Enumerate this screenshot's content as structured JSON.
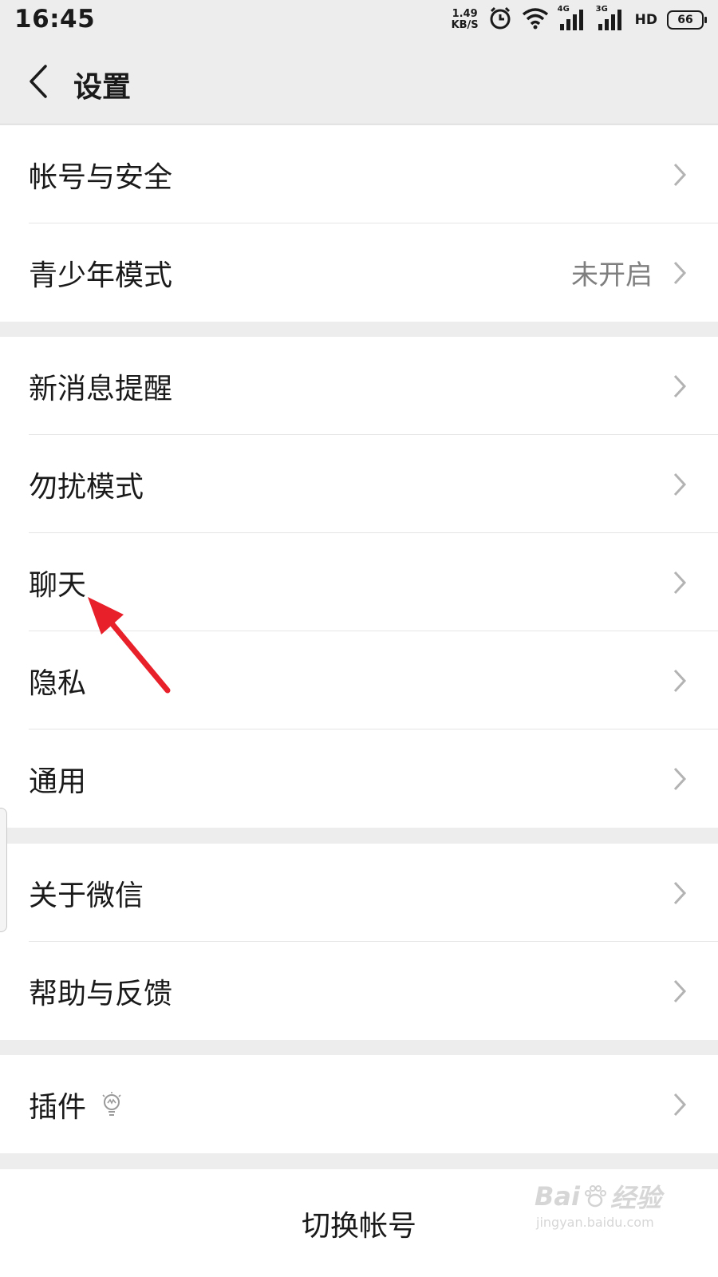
{
  "status_bar": {
    "time": "16:45",
    "net_speed_value": "1.49",
    "net_speed_unit": "KB/S",
    "signal1_label": "4G",
    "signal2_label": "3G",
    "hd_label": "HD",
    "battery": "66"
  },
  "header": {
    "title": "设置"
  },
  "groups": [
    {
      "items": [
        {
          "label": "帐号与安全",
          "value": ""
        },
        {
          "label": "青少年模式",
          "value": "未开启"
        }
      ]
    },
    {
      "items": [
        {
          "label": "新消息提醒",
          "value": ""
        },
        {
          "label": "勿扰模式",
          "value": ""
        },
        {
          "label": "聊天",
          "value": ""
        },
        {
          "label": "隐私",
          "value": ""
        },
        {
          "label": "通用",
          "value": ""
        }
      ]
    },
    {
      "items": [
        {
          "label": "关于微信",
          "value": ""
        },
        {
          "label": "帮助与反馈",
          "value": ""
        }
      ]
    },
    {
      "items": [
        {
          "label": "插件",
          "value": ""
        }
      ]
    }
  ],
  "footer": {
    "switch_account": "切换帐号"
  },
  "watermark": {
    "brand": "Bai",
    "brand_cn": "经验",
    "url": "jingyan.baidu.com"
  },
  "colors": {
    "background": "#ededed",
    "row_bg": "#ffffff",
    "text": "#1a1a1a",
    "secondary_text": "#7f7f7f",
    "annotation_arrow": "#e8202a"
  }
}
